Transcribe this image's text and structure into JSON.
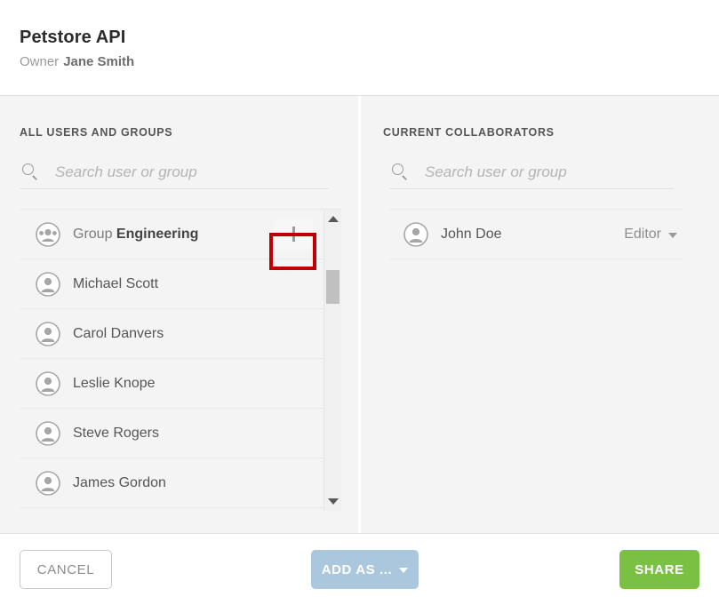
{
  "header": {
    "title": "Petstore API",
    "owner_label": "Owner",
    "owner_name": "Jane Smith"
  },
  "left_panel": {
    "title": "ALL USERS AND GROUPS",
    "search": {
      "placeholder": "Search user or group",
      "value": "",
      "icon": "search-icon"
    },
    "rows": [
      {
        "type": "group",
        "prefix": "Group",
        "name": "Engineering",
        "avatar": "group-avatar-icon",
        "action": "+",
        "highlighted": true
      },
      {
        "type": "user",
        "prefix": "",
        "name": "Michael Scott",
        "avatar": "user-avatar-icon",
        "action": "+",
        "highlighted": false
      },
      {
        "type": "user",
        "prefix": "",
        "name": "Carol Danvers",
        "avatar": "user-avatar-icon",
        "action": "+",
        "highlighted": false
      },
      {
        "type": "user",
        "prefix": "",
        "name": "Leslie Knope",
        "avatar": "user-avatar-icon",
        "action": "+",
        "highlighted": false
      },
      {
        "type": "user",
        "prefix": "",
        "name": "Steve Rogers",
        "avatar": "user-avatar-icon",
        "action": "+",
        "highlighted": false
      },
      {
        "type": "user",
        "prefix": "",
        "name": "James Gordon",
        "avatar": "user-avatar-icon",
        "action": "+",
        "highlighted": false
      }
    ],
    "scrollbar": {
      "up_arrow": "scroll-up-icon",
      "down_arrow": "scroll-down-icon"
    }
  },
  "right_panel": {
    "title": "CURRENT COLLABORATORS",
    "search": {
      "placeholder": "Search user or group",
      "value": "",
      "icon": "search-icon"
    },
    "rows": [
      {
        "name": "John Doe",
        "avatar": "user-avatar-icon",
        "role": "Editor"
      }
    ]
  },
  "footer": {
    "cancel_label": "CANCEL",
    "add_as_label": "ADD AS ...",
    "share_label": "SHARE"
  },
  "colors": {
    "highlight_box": "#c00000",
    "share_button": "#7ac143",
    "add_as_button": "#aac7dd",
    "panel_background": "#f4f4f4"
  }
}
